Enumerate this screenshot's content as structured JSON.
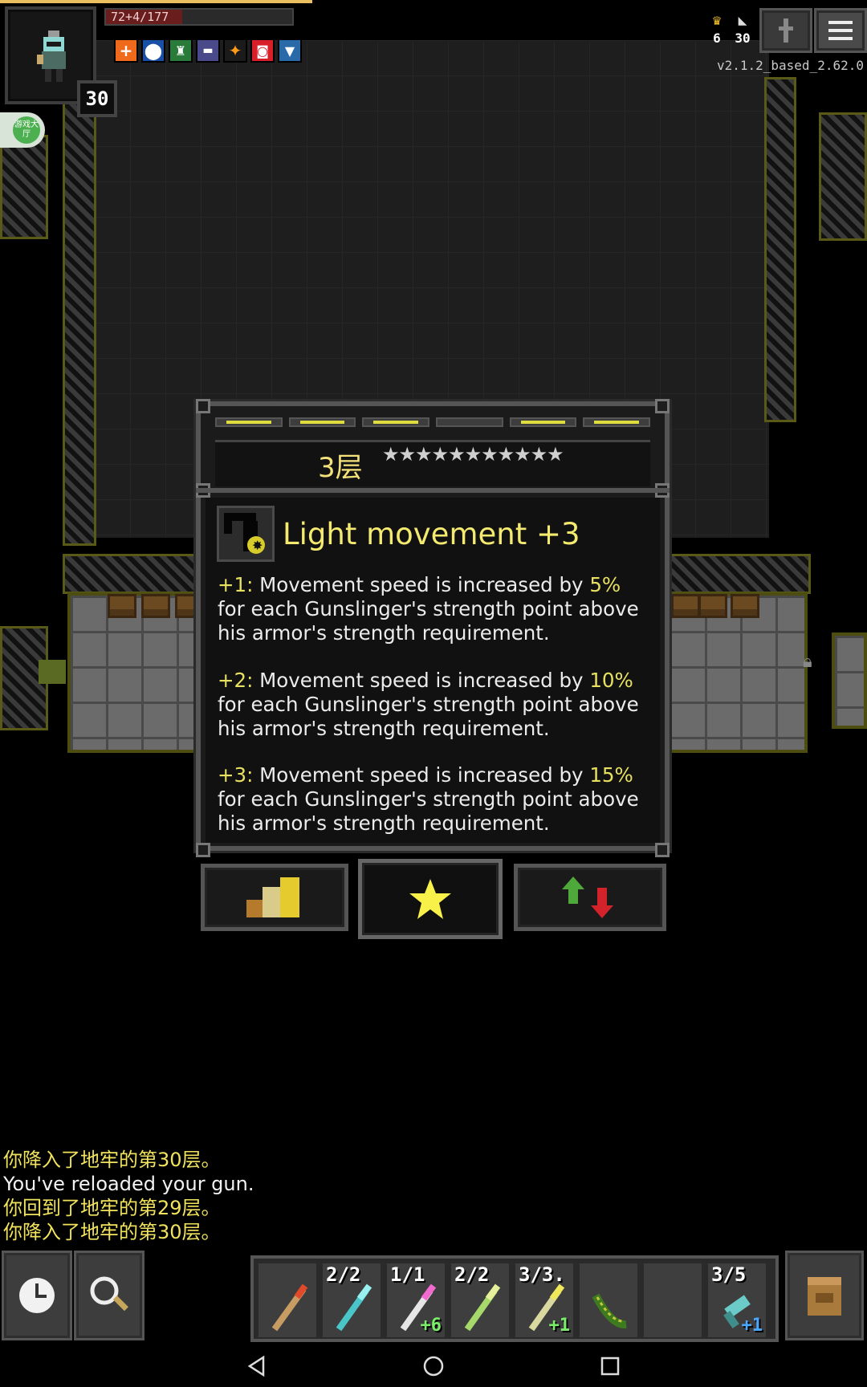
{
  "hud": {
    "hp_text": "72+4/177",
    "hp_fraction": 0.41,
    "xp_fraction": 0.36,
    "hero_level": "30",
    "buff_icons": [
      "health-cross-icon",
      "shield-icon",
      "castle-icon",
      "sword-icon",
      "bolt-icon",
      "rage-icon",
      "shield-blue-icon"
    ],
    "gamecenter_label": "游戏大厅"
  },
  "top_right": {
    "depth_stat": "6",
    "level_stat": "30",
    "journal_icon": "journal-icon",
    "menu_icon": "menu-icon",
    "version": "v2.1.2_based_2.62.0"
  },
  "talent_window": {
    "tier_title": "3层",
    "stars": "★★★★★★★★★★★",
    "talent_name": "Light movement +3",
    "desc1_prefix": "+1:",
    "desc1_a": " Movement speed is increased by ",
    "desc1_value": "5%",
    "desc1_b": " for each Gunslinger's strength point above his armor's strength requirement.",
    "desc2_prefix": "+2:",
    "desc2_a": " Movement speed is increased by ",
    "desc2_value": "10%",
    "desc2_b": " for each Gunslinger's strength point above his armor's strength requirement.",
    "desc3_prefix": "+3:",
    "desc3_a": " Movement speed is increased by ",
    "desc3_value": "15%",
    "desc3_b": " for each Gunslinger's strength point above his armor's strength requirement.",
    "tabs": [
      "stats-bars-icon",
      "talent-star-icon",
      "up-down-arrows-icon"
    ]
  },
  "log": [
    {
      "text": "你降入了地牢的第30层。",
      "color": "yellow"
    },
    {
      "text": "You've reloaded your gun.",
      "color": "white"
    },
    {
      "text": "你回到了地牢的第29层。",
      "color": "yellow"
    },
    {
      "text": "你降入了地牢的第30层。",
      "color": "yellow"
    }
  ],
  "quickbar": [
    {
      "count": "",
      "plus": ""
    },
    {
      "count": "2/2",
      "plus": ""
    },
    {
      "count": "1/1",
      "plus": "+6"
    },
    {
      "count": "2/2",
      "plus": ""
    },
    {
      "count": "3/3.",
      "plus": "+1"
    },
    {
      "count": "",
      "plus": ""
    },
    {
      "count": "",
      "plus": ""
    },
    {
      "count": "3/5",
      "plus": "+1"
    }
  ],
  "colors": {
    "accent_yellow": "#f4ea70",
    "highlight": "#e8e060",
    "plus_green": "#7bed6b",
    "plus_blue": "#4aa8ff"
  }
}
